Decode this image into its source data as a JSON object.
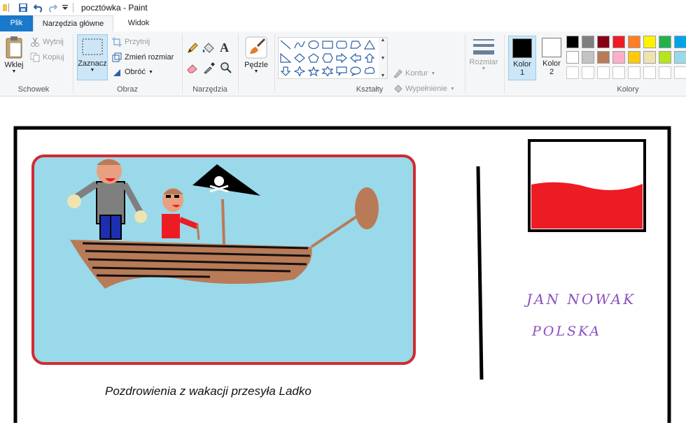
{
  "window": {
    "title": "pocztówka - Paint"
  },
  "tabs": {
    "file": "Plik",
    "home": "Narzędzia główne",
    "view": "Widok"
  },
  "clipboard": {
    "paste": "Wklej",
    "cut": "Wytnij",
    "copy": "Kopiuj",
    "label": "Schowek"
  },
  "image": {
    "select": "Zaznacz",
    "crop": "Przytnij",
    "resize": "Zmień rozmiar",
    "rotate": "Obróć",
    "label": "Obraz"
  },
  "tools": {
    "label": "Narzędzia"
  },
  "brushes": {
    "label": "Pędzle"
  },
  "shapes": {
    "outline": "Kontur",
    "fill": "Wypełnienie",
    "label": "Kształty"
  },
  "size": {
    "label": "Rozmiar"
  },
  "colors": {
    "color1": "Kolor 1",
    "color1_line2": "1",
    "color1_line1": "Kolor",
    "color2_line1": "Kolor",
    "color2_line2": "2",
    "label": "Kolory",
    "primary": "#000000",
    "secondary": "#ffffff",
    "palette": [
      "#000000",
      "#7f7f7f",
      "#880015",
      "#ed1c24",
      "#ff7f27",
      "#fff200",
      "#22b14c",
      "#00a2e8",
      "#3f48cc",
      "#ffffff",
      "#c3c3c3",
      "#b97a57",
      "#ffaec9",
      "#ffc90e",
      "#efe4b0",
      "#b5e61d",
      "#99d9ea",
      "#7092be",
      "",
      "",
      "",
      "",
      "",
      "",
      "",
      "",
      ""
    ]
  },
  "postcard": {
    "caption": "Pozdrowienia z wakacji przesyła Ladko",
    "address_line1": "JAN NOWAK",
    "address_line2": "POLSKA"
  }
}
